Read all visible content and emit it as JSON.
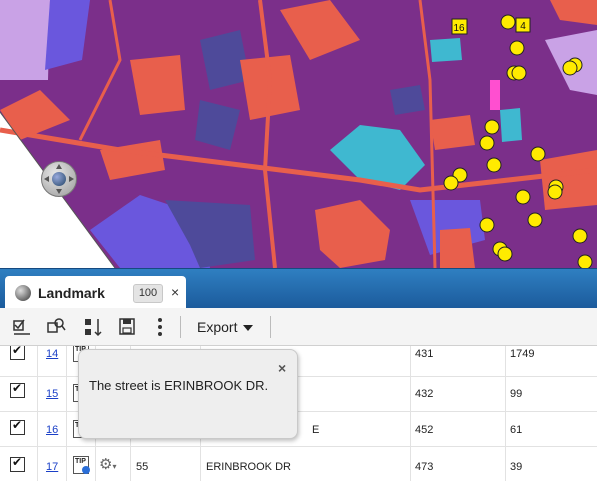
{
  "map": {
    "colors": {
      "land": "#7b2f8a",
      "residential": "#e85f4c",
      "park": "#3fb8d0",
      "commercial": "#4e4a9a",
      "industrial": "#6a57dd",
      "outside": "#c9a2e6",
      "marker": "#ffeb00"
    },
    "cluster_labels": [
      "16",
      "4"
    ]
  },
  "tab": {
    "label": "Landmark",
    "count": "100",
    "close_glyph": "×"
  },
  "toolbar": {
    "export_label": "Export"
  },
  "rows": [
    {
      "id": "14",
      "icon_text": "TIP",
      "col3": "",
      "name": "",
      "a": "431",
      "b": "1749"
    },
    {
      "id": "15",
      "icon_text": "TIP",
      "col3": "",
      "name": "",
      "a": "432",
      "b": "99"
    },
    {
      "id": "16",
      "icon_text": "TIP",
      "col3": "",
      "name": "E",
      "a": "452",
      "b": "61"
    },
    {
      "id": "17",
      "icon_text": "TIP",
      "col3": "55",
      "name": "ERINBROOK DR",
      "a": "473",
      "b": "39"
    }
  ],
  "tooltip": {
    "message": "The street is ERINBROOK DR.",
    "close_glyph": "×"
  }
}
